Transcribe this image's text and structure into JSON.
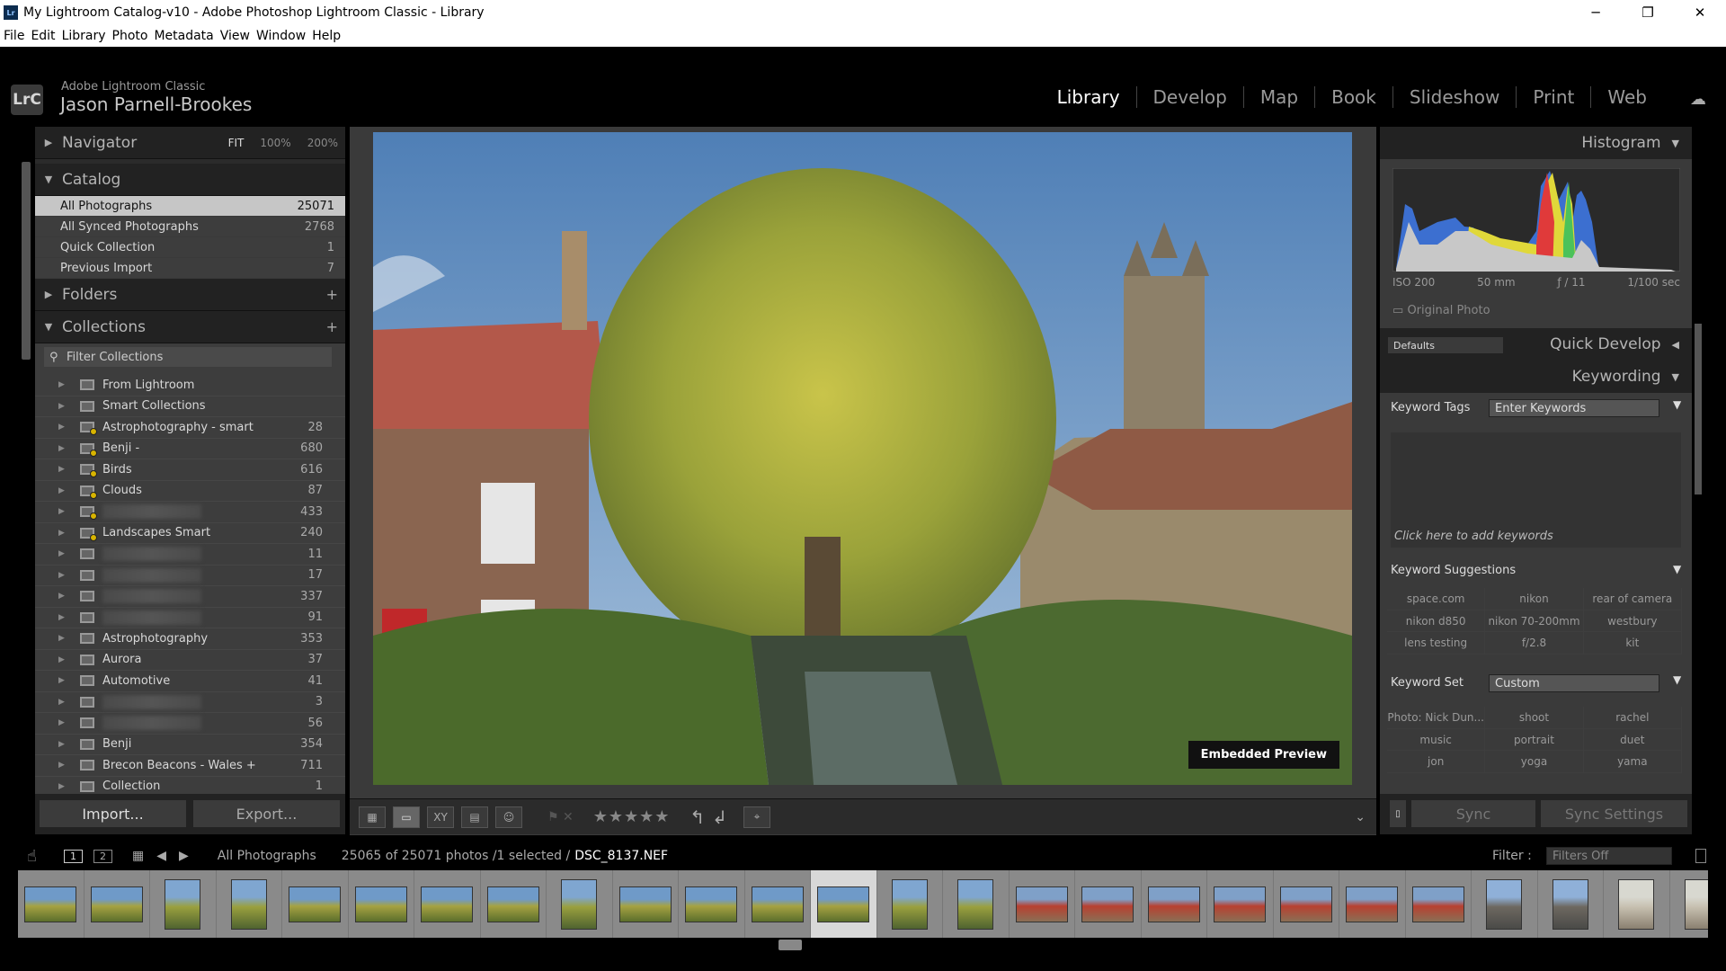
{
  "window": {
    "title": "My Lightroom Catalog-v10 - Adobe Photoshop Lightroom Classic - Library",
    "controls": [
      "minimize",
      "restore",
      "close"
    ]
  },
  "menu": [
    "File",
    "Edit",
    "Library",
    "Photo",
    "Metadata",
    "View",
    "Window",
    "Help"
  ],
  "identity": {
    "badge": "LrC",
    "product": "Adobe Lightroom Classic",
    "user": "Jason Parnell-Brookes"
  },
  "modules": [
    {
      "label": "Library",
      "active": true
    },
    {
      "label": "Develop"
    },
    {
      "label": "Map"
    },
    {
      "label": "Book"
    },
    {
      "label": "Slideshow"
    },
    {
      "label": "Print"
    },
    {
      "label": "Web"
    }
  ],
  "navigator": {
    "title": "Navigator",
    "options": [
      "FIT",
      "100%",
      "200%"
    ]
  },
  "catalog": {
    "title": "Catalog",
    "items": [
      {
        "label": "All Photographs",
        "count": "25071",
        "selected": true
      },
      {
        "label": "All Synced Photographs",
        "count": "2768"
      },
      {
        "label": "Quick Collection",
        "count": "1"
      },
      {
        "label": "Previous Import",
        "count": "7"
      }
    ]
  },
  "folders": {
    "title": "Folders"
  },
  "collections": {
    "title": "Collections",
    "filter_placeholder": "Filter Collections",
    "items": [
      {
        "label": "From Lightroom",
        "count": "",
        "type": "set"
      },
      {
        "label": "Smart Collections",
        "count": "",
        "type": "set"
      },
      {
        "label": "Astrophotography - smart",
        "count": "28",
        "type": "smart"
      },
      {
        "label": "Benji -",
        "count": "680",
        "type": "smart"
      },
      {
        "label": "Birds",
        "count": "616",
        "type": "smart"
      },
      {
        "label": "Clouds",
        "count": "87",
        "type": "smart"
      },
      {
        "label": "",
        "count": "433",
        "type": "smart",
        "blurred": true
      },
      {
        "label": "Landscapes Smart",
        "count": "240",
        "type": "smart"
      },
      {
        "label": "",
        "count": "11",
        "type": "collection",
        "blurred": true
      },
      {
        "label": "",
        "count": "17",
        "type": "collection",
        "blurred": true
      },
      {
        "label": "",
        "count": "337",
        "type": "collection",
        "blurred": true
      },
      {
        "label": "",
        "count": "91",
        "type": "collection",
        "blurred": true
      },
      {
        "label": "Astrophotography",
        "count": "353",
        "type": "collection"
      },
      {
        "label": "Aurora",
        "count": "37",
        "type": "collection"
      },
      {
        "label": "Automotive",
        "count": "41",
        "type": "collection"
      },
      {
        "label": "",
        "count": "3",
        "type": "collection",
        "blurred": true
      },
      {
        "label": "",
        "count": "56",
        "type": "collection",
        "blurred": true
      },
      {
        "label": "Benji",
        "count": "354",
        "type": "collection"
      },
      {
        "label": "Brecon Beacons - Wales  +",
        "count": "711",
        "type": "collection"
      },
      {
        "label": "Collection",
        "count": "1",
        "type": "collection"
      }
    ]
  },
  "buttons": {
    "import": "Import...",
    "export": "Export...",
    "sync": "Sync",
    "sync_settings": "Sync Settings"
  },
  "preview": {
    "badge": "Embedded Preview"
  },
  "toolbar": {
    "rating_stars": "★★★★★"
  },
  "histogram": {
    "title": "Histogram",
    "iso": "ISO 200",
    "focal": "50 mm",
    "aperture": "ƒ / 11",
    "shutter": "1/100 sec",
    "original_photo": "Original Photo"
  },
  "quick_develop": {
    "title": "Quick Develop",
    "preset": "Defaults"
  },
  "keywording": {
    "title": "Keywording",
    "tags_label": "Keyword Tags",
    "tags_value": "Enter Keywords",
    "click_hint": "Click here to add keywords",
    "suggestions_title": "Keyword Suggestions",
    "suggestions": [
      "space.com",
      "nikon",
      "rear of camera",
      "nikon d850",
      "nikon 70-200mm",
      "westbury",
      "lens testing",
      "f/2.8",
      "kit"
    ],
    "set_label": "Keyword Set",
    "set_value": "Custom",
    "set_keywords": [
      "Photo: Nick Dun...",
      "shoot",
      "rachel",
      "music",
      "portrait",
      "duet",
      "jon",
      "yoga",
      "yama"
    ]
  },
  "filmbar": {
    "source": "All Photographs",
    "status": "25065 of 25071 photos /1 selected /",
    "filename": "DSC_8137.NEF",
    "filter_label": "Filter :",
    "filter_value": "Filters Off",
    "pages": [
      "1",
      "2"
    ]
  },
  "filmstrip": {
    "selected_index": 12,
    "thumbs": [
      "l",
      "l",
      "p",
      "p",
      "l",
      "l",
      "l",
      "l",
      "p",
      "l",
      "l",
      "l",
      "l",
      "p",
      "p",
      "r",
      "r",
      "r",
      "r",
      "r",
      "r",
      "r",
      "b",
      "b",
      "w",
      "w"
    ]
  }
}
